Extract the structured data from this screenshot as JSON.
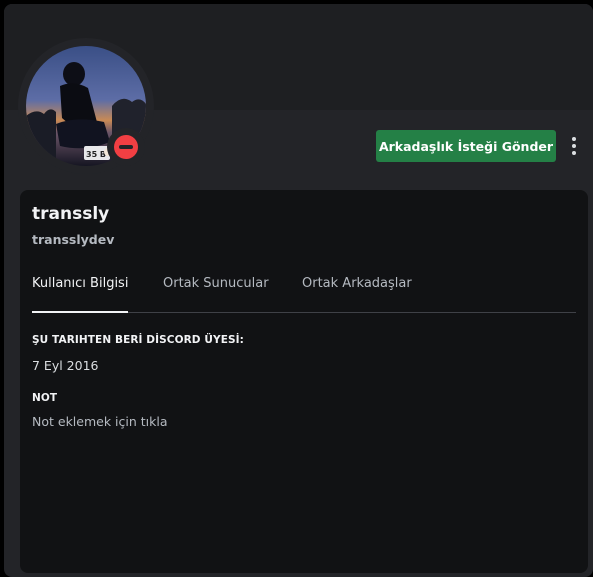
{
  "profile": {
    "display_name": "transsly",
    "username": "transslydev",
    "status": "do-not-disturb",
    "status_icon": "dnd-icon"
  },
  "actions": {
    "friend_request_label": "Arkadaşlık İsteği Gönder",
    "more_icon": "more-vertical-icon"
  },
  "tabs": [
    {
      "label": "Kullanıcı Bilgisi",
      "active": true
    },
    {
      "label": "Ortak Sunucular",
      "active": false
    },
    {
      "label": "Ortak Arkadaşlar",
      "active": false
    }
  ],
  "member_since": {
    "title": "ŞU TARIHTEN BERİ DİSCORD ÜYESİ:",
    "value": "7 Eyl 2016"
  },
  "note": {
    "title": "NOT",
    "placeholder": "Not eklemek için tıkla"
  },
  "colors": {
    "accent_green": "#248046",
    "dnd_red": "#f23f43",
    "panel": "#232428",
    "card": "#111214"
  }
}
